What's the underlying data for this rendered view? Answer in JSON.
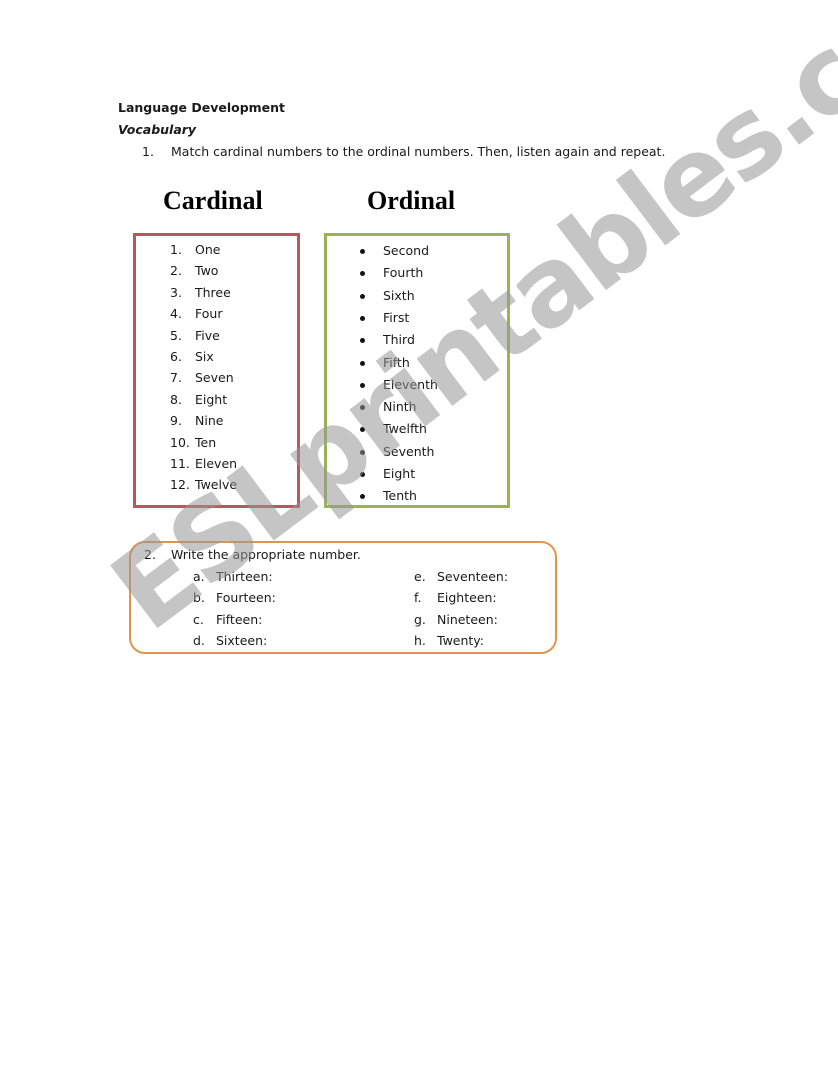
{
  "header": {
    "title": "Language Development",
    "subtitle": "Vocabulary"
  },
  "exercise1": {
    "number": "1.",
    "instruction": "Match cardinal numbers to the ordinal numbers. Then, listen again and repeat.",
    "cardinal_title": "Cardinal",
    "ordinal_title": "Ordinal",
    "cardinal": [
      {
        "num": "1.",
        "word": "One"
      },
      {
        "num": "2.",
        "word": "Two"
      },
      {
        "num": "3.",
        "word": "Three"
      },
      {
        "num": "4.",
        "word": "Four"
      },
      {
        "num": "5.",
        "word": "Five"
      },
      {
        "num": "6.",
        "word": "Six"
      },
      {
        "num": "7.",
        "word": "Seven"
      },
      {
        "num": "8.",
        "word": "Eight"
      },
      {
        "num": "9.",
        "word": "Nine"
      },
      {
        "num": "10.",
        "word": "Ten"
      },
      {
        "num": "11.",
        "word": "Eleven"
      },
      {
        "num": "12.",
        "word": "Twelve"
      }
    ],
    "ordinal": [
      "Second",
      "Fourth",
      "Sixth",
      "First",
      "Third",
      "Fifth",
      "Eleventh",
      "Ninth",
      "Twelfth",
      "Seventh",
      "Eight",
      "Tenth"
    ]
  },
  "exercise2": {
    "number": "2.",
    "instruction": "Write the appropriate number.",
    "items": [
      {
        "letter": "a.",
        "word": "Thirteen:"
      },
      {
        "letter": "b.",
        "word": "Fourteen:"
      },
      {
        "letter": "c.",
        "word": "Fifteen:"
      },
      {
        "letter": "d.",
        "word": "Sixteen:"
      },
      {
        "letter": "e.",
        "word": "Seventeen:"
      },
      {
        "letter": "f.",
        "word": "Eighteen:"
      },
      {
        "letter": "g.",
        "word": "Nineteen:"
      },
      {
        "letter": "h.",
        "word": "Twenty:"
      }
    ]
  },
  "colors": {
    "cardinal_border": "#b55a5c",
    "ordinal_border": "#9ab35a",
    "exercise2_border": "#e0954e"
  },
  "watermark": "ESLprintables.com"
}
